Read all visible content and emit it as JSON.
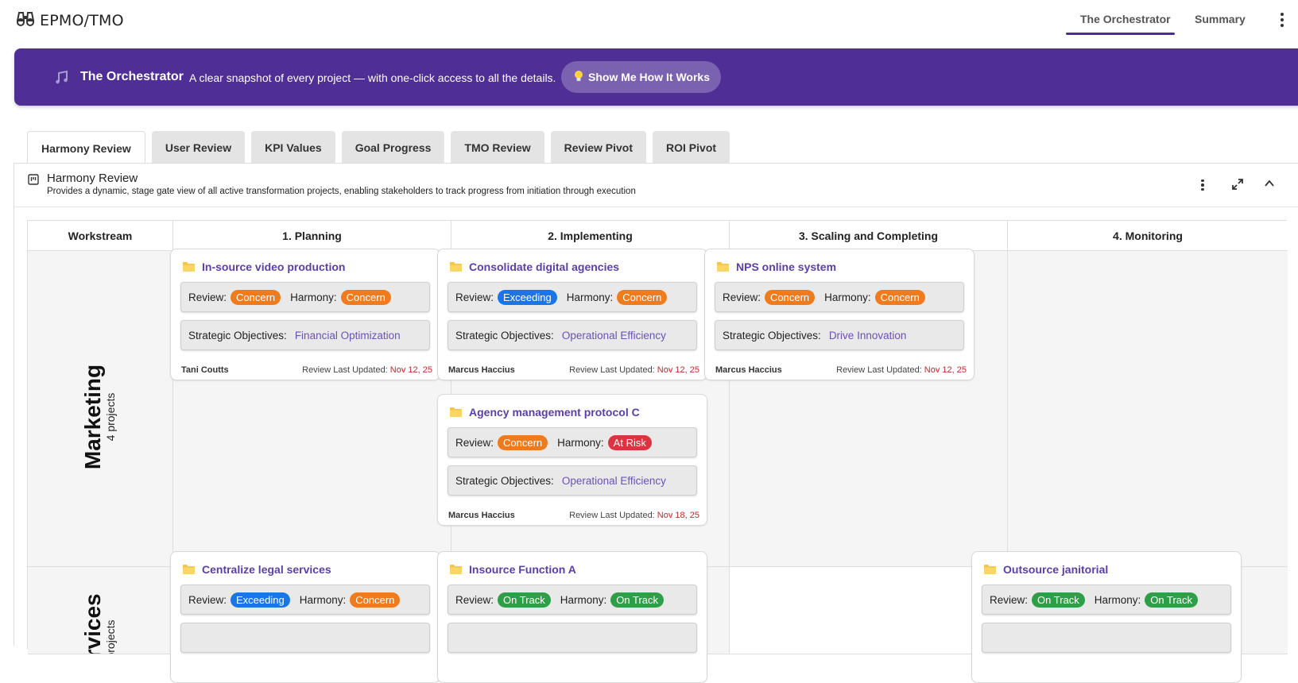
{
  "app": {
    "title": "EPMO/TMO"
  },
  "nav": {
    "items": [
      "The Orchestrator",
      "Summary"
    ]
  },
  "banner": {
    "title": "The Orchestrator",
    "subtitle": "A clear snapshot of every project — with one-click access to all the details.",
    "button_label": "Show Me How It Works"
  },
  "tabs": [
    "Harmony Review",
    "User Review",
    "KPI Values",
    "Goal Progress",
    "TMO Review",
    "Review Pivot",
    "ROI Pivot"
  ],
  "panel": {
    "title": "Harmony Review",
    "description": "Provides a dynamic, stage gate view of all active transformation projects, enabling stakeholders to track progress from initiation through execution"
  },
  "board": {
    "columns": [
      "Workstream",
      "1. Planning",
      "2. Implementing",
      "3. Scaling and Completing",
      "4. Monitoring"
    ],
    "workstreams": [
      {
        "name": "Marketing",
        "count": "4 projects"
      },
      {
        "name": "Services",
        "count": "projects"
      }
    ],
    "labels": {
      "review": "Review:",
      "harmony": "Harmony:",
      "objectives": "Strategic Objectives:",
      "updated": "Review Last Updated:"
    },
    "cards": [
      {
        "title": "In-source video production",
        "review": "Concern",
        "harmony": "Concern",
        "objective": "Financial Optimization",
        "owner": "Tani Coutts",
        "date": "Nov 12, 25"
      },
      {
        "title": "Consolidate digital agencies",
        "review": "Exceeding",
        "harmony": "Concern",
        "objective": "Operational Efficiency",
        "owner": "Marcus Haccius",
        "date": "Nov 12, 25"
      },
      {
        "title": "NPS online system",
        "review": "Concern",
        "harmony": "Concern",
        "objective": "Drive Innovation",
        "owner": "Marcus Haccius",
        "date": "Nov 12, 25"
      },
      {
        "title": "Agency management protocol C",
        "review": "Concern",
        "harmony": "At Risk",
        "objective": "Operational Efficiency",
        "owner": "Marcus Haccius",
        "date": "Nov 18, 25"
      },
      {
        "title": "Centralize legal services",
        "review": "Exceeding",
        "harmony": "Concern"
      },
      {
        "title": "Insource Function A",
        "review": "On Track",
        "harmony": "On Track"
      },
      {
        "title": "Outsource janitorial",
        "review": "On Track",
        "harmony": "On Track"
      }
    ]
  },
  "status_colors": {
    "Concern": "#f07b1d",
    "Exceeding": "#1976e8",
    "At Risk": "#d9343f",
    "On Track": "#2e9e47"
  },
  "colors": {
    "brand": "#4f2e96",
    "accent_link": "#5b3fa8",
    "date": "#c62828"
  }
}
